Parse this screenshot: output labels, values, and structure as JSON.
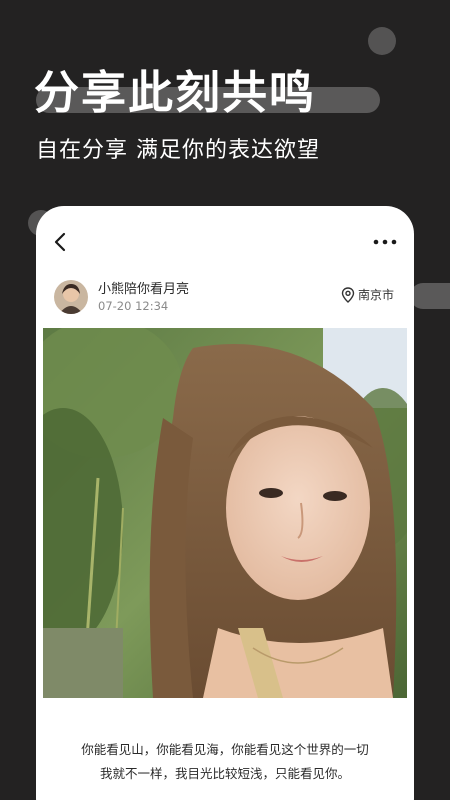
{
  "promo": {
    "headline": "分享此刻共鸣",
    "subline": "自在分享 满足你的表达欲望"
  },
  "post": {
    "username": "小熊陪你看月亮",
    "time": "07-20 12:34",
    "location": "南京市",
    "caption_lines": [
      "你能看见山，你能看见海，你能看见这个世界的一切",
      "我就不一样，我目光比较短浅，只能看见你。"
    ]
  },
  "icons": {
    "back": "chevron-left-icon",
    "more": "more-dots-icon",
    "location": "location-pin-icon"
  },
  "colors": {
    "background": "#232222",
    "decoration": "#5a5959",
    "card": "#ffffff",
    "headline": "#ffffff"
  }
}
